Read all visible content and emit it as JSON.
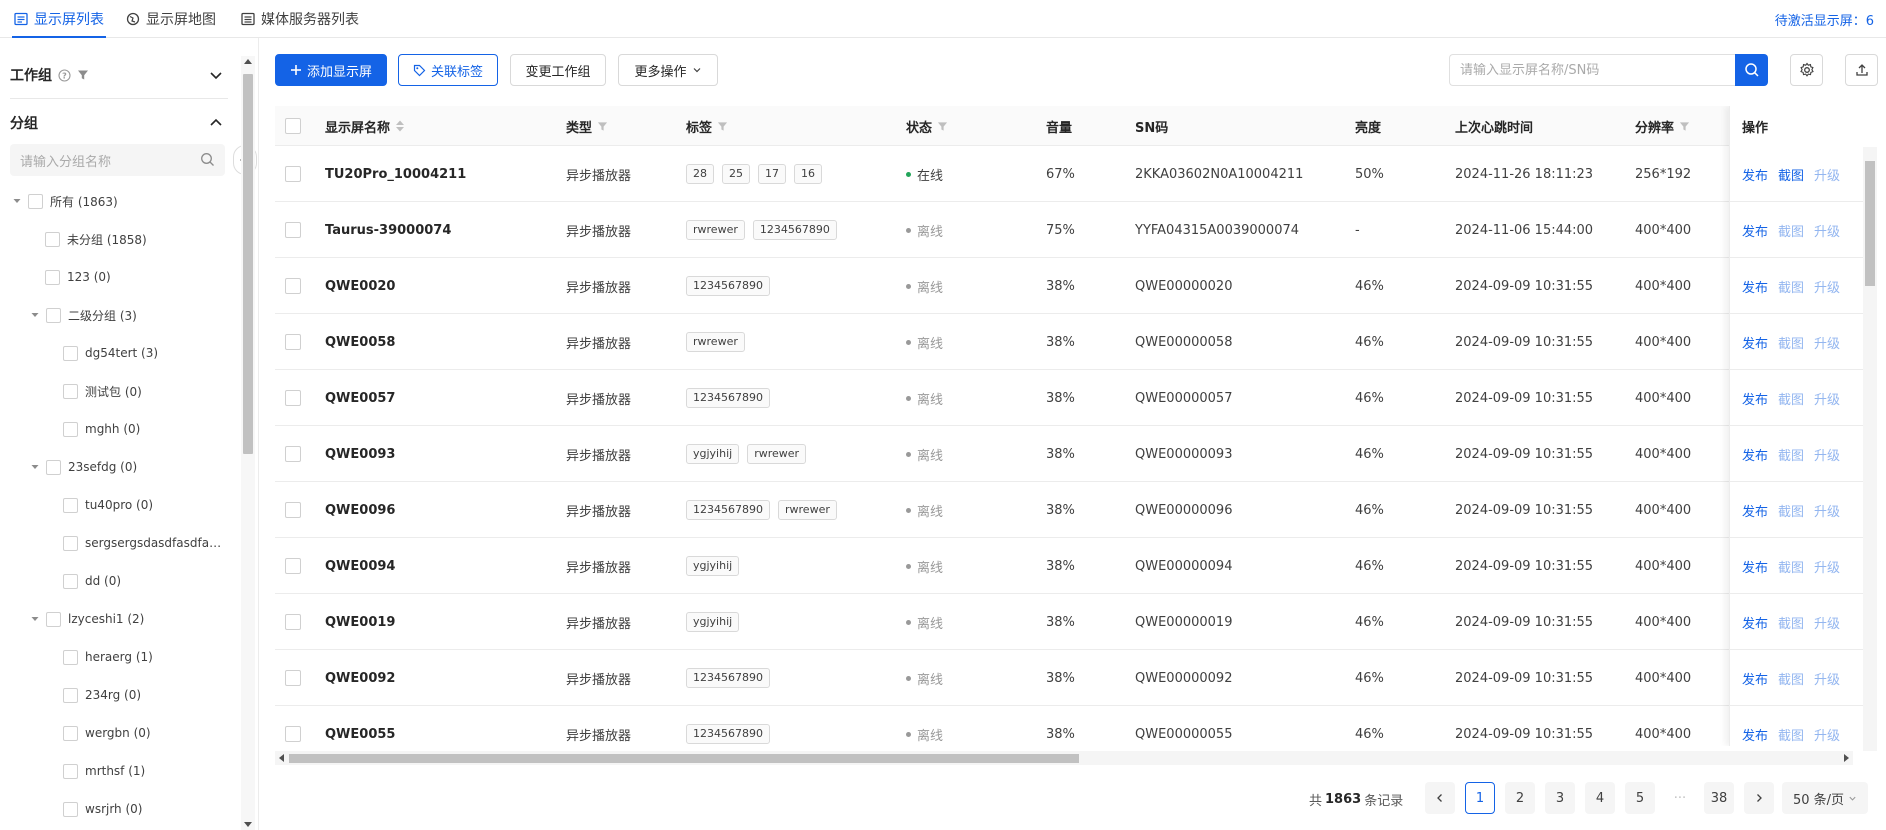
{
  "tabs": [
    {
      "label": "显示屏列表",
      "icon": "list-icon",
      "active": true
    },
    {
      "label": "显示屏地图",
      "icon": "map-icon",
      "active": false
    },
    {
      "label": "媒体服务器列表",
      "icon": "server-list-icon",
      "active": false
    }
  ],
  "pending_label": "待激活显示屏：6",
  "sidebar": {
    "workgroup_label": "工作组",
    "group_label": "分组",
    "search_placeholder": "请输入分组名称",
    "tree": [
      {
        "label": "所有 (1863)",
        "level": 0,
        "expanded": true
      },
      {
        "label": "未分组 (1858)",
        "level": 1
      },
      {
        "label": "123 (0)",
        "level": 1
      },
      {
        "label": "二级分组 (3)",
        "level": 1,
        "expanded": true
      },
      {
        "label": "dg54tert (3)",
        "level": 2
      },
      {
        "label": "测试包 (0)",
        "level": 2
      },
      {
        "label": "mghh (0)",
        "level": 2
      },
      {
        "label": "23sefdg (0)",
        "level": 1,
        "expanded": true
      },
      {
        "label": "tu40pro (0)",
        "level": 2
      },
      {
        "label": "sergsergsdasdfasdfasdf...",
        "level": 2
      },
      {
        "label": "dd (0)",
        "level": 2
      },
      {
        "label": "lzyceshi1 (2)",
        "level": 1,
        "expanded": true
      },
      {
        "label": "heraerg (1)",
        "level": 2
      },
      {
        "label": "234rg (0)",
        "level": 2
      },
      {
        "label": "wergbn (0)",
        "level": 2
      },
      {
        "label": "mrthsf (1)",
        "level": 2
      },
      {
        "label": "wsrjrh (0)",
        "level": 2
      }
    ]
  },
  "toolbar": {
    "add_label": "添加显示屏",
    "tag_label": "关联标签",
    "change_group_label": "变更工作组",
    "more_label": "更多操作",
    "search_placeholder": "请输入显示屏名称/SN码"
  },
  "table": {
    "columns": [
      "显示屏名称",
      "类型",
      "标签",
      "状态",
      "音量",
      "SN码",
      "亮度",
      "上次心跳时间",
      "分辨率",
      "操作"
    ],
    "actions": [
      "发布",
      "截图",
      "升级"
    ],
    "rows": [
      {
        "name": "TU20Pro_10004211",
        "type": "异步播放器",
        "tags": [
          "28",
          "25",
          "17",
          "16"
        ],
        "status": "在线",
        "online": true,
        "volume": "67%",
        "sn": "2KKA03602N0A10004211",
        "brightness": "50%",
        "heartbeat": "2024-11-26 18:11:23",
        "resolution": "256*192"
      },
      {
        "name": "Taurus-39000074",
        "type": "异步播放器",
        "tags": [
          "rwrewer",
          "1234567890"
        ],
        "status": "离线",
        "online": false,
        "volume": "75%",
        "sn": "YYFA04315A0039000074",
        "brightness": "-",
        "heartbeat": "2024-11-06 15:44:00",
        "resolution": "400*400"
      },
      {
        "name": "QWE0020",
        "type": "异步播放器",
        "tags": [
          "1234567890"
        ],
        "status": "离线",
        "online": false,
        "volume": "38%",
        "sn": "QWE00000020",
        "brightness": "46%",
        "heartbeat": "2024-09-09 10:31:55",
        "resolution": "400*400"
      },
      {
        "name": "QWE0058",
        "type": "异步播放器",
        "tags": [
          "rwrewer"
        ],
        "status": "离线",
        "online": false,
        "volume": "38%",
        "sn": "QWE00000058",
        "brightness": "46%",
        "heartbeat": "2024-09-09 10:31:55",
        "resolution": "400*400"
      },
      {
        "name": "QWE0057",
        "type": "异步播放器",
        "tags": [
          "1234567890"
        ],
        "status": "离线",
        "online": false,
        "volume": "38%",
        "sn": "QWE00000057",
        "brightness": "46%",
        "heartbeat": "2024-09-09 10:31:55",
        "resolution": "400*400"
      },
      {
        "name": "QWE0093",
        "type": "异步播放器",
        "tags": [
          "ygjyihij",
          "rwrewer"
        ],
        "status": "离线",
        "online": false,
        "volume": "38%",
        "sn": "QWE00000093",
        "brightness": "46%",
        "heartbeat": "2024-09-09 10:31:55",
        "resolution": "400*400"
      },
      {
        "name": "QWE0096",
        "type": "异步播放器",
        "tags": [
          "1234567890",
          "rwrewer"
        ],
        "status": "离线",
        "online": false,
        "volume": "38%",
        "sn": "QWE00000096",
        "brightness": "46%",
        "heartbeat": "2024-09-09 10:31:55",
        "resolution": "400*400"
      },
      {
        "name": "QWE0094",
        "type": "异步播放器",
        "tags": [
          "ygjyihij"
        ],
        "status": "离线",
        "online": false,
        "volume": "38%",
        "sn": "QWE00000094",
        "brightness": "46%",
        "heartbeat": "2024-09-09 10:31:55",
        "resolution": "400*400"
      },
      {
        "name": "QWE0019",
        "type": "异步播放器",
        "tags": [
          "ygjyihij"
        ],
        "status": "离线",
        "online": false,
        "volume": "38%",
        "sn": "QWE00000019",
        "brightness": "46%",
        "heartbeat": "2024-09-09 10:31:55",
        "resolution": "400*400"
      },
      {
        "name": "QWE0092",
        "type": "异步播放器",
        "tags": [
          "1234567890"
        ],
        "status": "离线",
        "online": false,
        "volume": "38%",
        "sn": "QWE00000092",
        "brightness": "46%",
        "heartbeat": "2024-09-09 10:31:55",
        "resolution": "400*400"
      },
      {
        "name": "QWE0055",
        "type": "异步播放器",
        "tags": [
          "1234567890"
        ],
        "status": "离线",
        "online": false,
        "volume": "38%",
        "sn": "QWE00000055",
        "brightness": "46%",
        "heartbeat": "2024-09-09 10:31:55",
        "resolution": "400*400"
      }
    ]
  },
  "pagination": {
    "total_prefix": "共",
    "total": "1863",
    "total_suffix": "条记录",
    "pages": [
      "1",
      "2",
      "3",
      "4",
      "5"
    ],
    "ellipsis": "···",
    "last": "38",
    "current": "1",
    "page_size": "50 条/页"
  },
  "colors": {
    "primary": "#1463e6",
    "online": "#23a55a",
    "offline": "#999999"
  }
}
